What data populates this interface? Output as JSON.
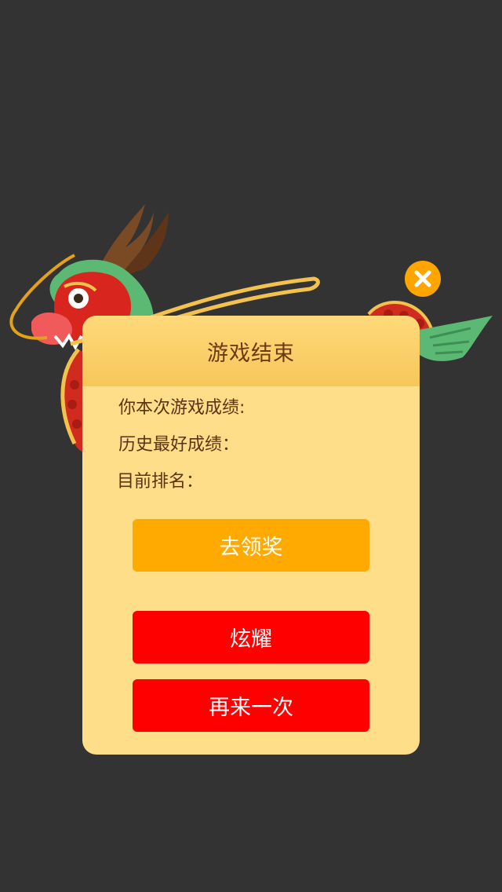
{
  "dialog": {
    "title": "游戏结束",
    "score_label": "你本次游戏成绩:",
    "best_label": "历史最好成绩：",
    "rank_label": "目前排名："
  },
  "buttons": {
    "claim_label": "去领奖",
    "show_off_label": "炫耀",
    "retry_label": "再来一次"
  },
  "icons": {
    "close": "close-icon",
    "decoration": "dragon-icon"
  },
  "colors": {
    "background": "#333333",
    "panel": "#FFDE8A",
    "panel_header": "#F6C75A",
    "claim_button": "#FFAA00",
    "action_button": "#FF0000",
    "close_button": "#FFA500",
    "text": "#5A3311"
  }
}
